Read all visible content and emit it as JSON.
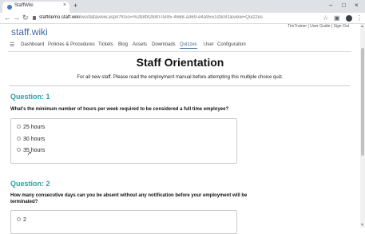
{
  "browser": {
    "tab_title": "StaffWiki",
    "tab_close": "×",
    "new_tab": "+",
    "win_minimize": "–",
    "win_maximize": "□",
    "win_close": "×",
    "back": "←",
    "forward": "→",
    "reload": "↻",
    "url_host": "staffdemo.staff.wiki",
    "url_path": "/ws/dataview.aspx?fcoo=%2b8f82b80-0e95-4668-a369-e4a9551d3c81&view=Quizzes",
    "toolbar_icons": {
      "star": "☆",
      "extension": "▣",
      "menu": "⋮"
    }
  },
  "site": {
    "logo": "staff.wiki",
    "user_links": "TimTrainer | User Guide | Sign Out",
    "nav": [
      "Dashboard",
      "Policies & Procedures",
      "Tickets",
      "Blog",
      "Assets",
      "Downloads",
      "Quizzes",
      "User",
      "Configuration"
    ],
    "active_nav": "Quizzes"
  },
  "quiz": {
    "title": "Staff Orientation",
    "intro": "For all new staff. Please read the employment manual before attempting this multiple choice quiz.",
    "questions": [
      {
        "heading": "Question: 1",
        "text": "What's the minimum number of hours per week required to be considered a full time employee?",
        "answers": [
          "25 hours",
          "30 hours",
          "35 hours"
        ]
      },
      {
        "heading": "Question: 2",
        "text": "How many consecutive days can you be absent without any notification before your employment will be terminated?",
        "answers": [
          "2"
        ]
      }
    ]
  }
}
